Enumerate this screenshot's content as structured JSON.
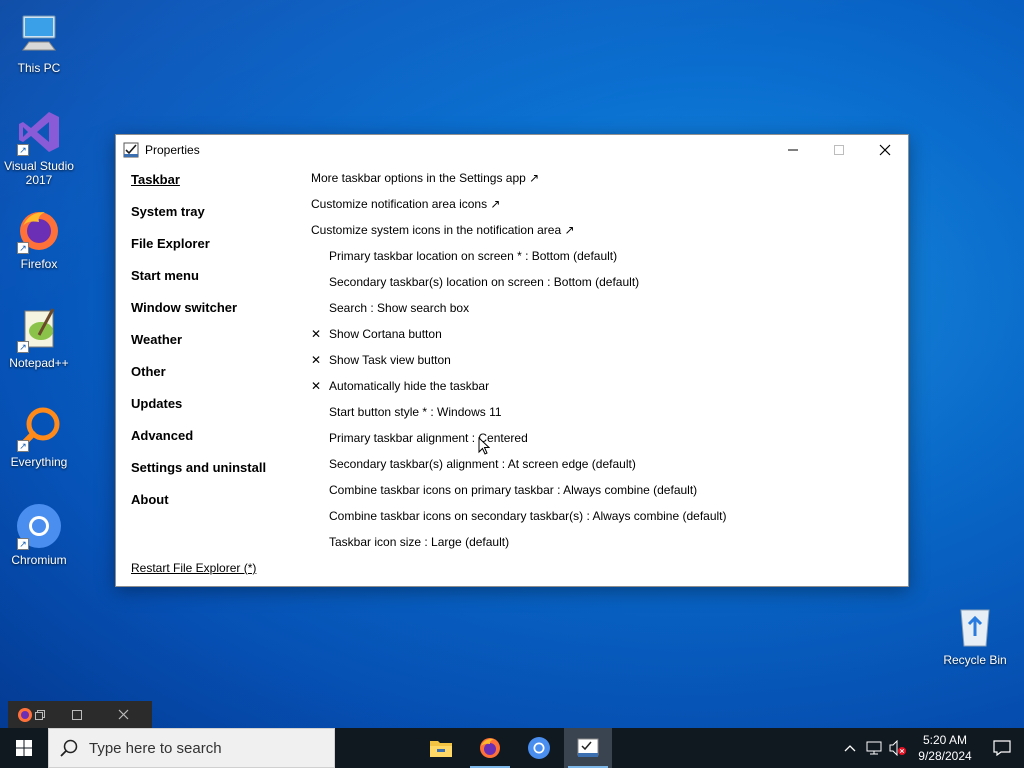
{
  "desktop": {
    "icons": [
      {
        "label": "This PC",
        "icon": "computer-icon"
      },
      {
        "label": "Visual Studio 2017",
        "icon": "visual-studio-icon"
      },
      {
        "label": "Firefox",
        "icon": "firefox-icon"
      },
      {
        "label": "Notepad++",
        "icon": "notepadpp-icon"
      },
      {
        "label": "Everything",
        "icon": "everything-search-icon"
      },
      {
        "label": "Chromium",
        "icon": "chromium-icon"
      },
      {
        "label": "Recycle Bin",
        "icon": "recycle-bin-icon"
      }
    ]
  },
  "window": {
    "title": "Properties",
    "icon": "properties-app-icon",
    "nav": [
      {
        "label": "Taskbar",
        "active": true
      },
      {
        "label": "System tray"
      },
      {
        "label": "File Explorer"
      },
      {
        "label": "Start menu"
      },
      {
        "label": "Window switcher"
      },
      {
        "label": "Weather"
      },
      {
        "label": "Other"
      },
      {
        "label": "Updates"
      },
      {
        "label": "Advanced"
      },
      {
        "label": "Settings and uninstall"
      },
      {
        "label": "About"
      }
    ],
    "restart_link": "Restart File Explorer (*)",
    "options": [
      {
        "text": "More taskbar options in the Settings app ↗",
        "type": "link"
      },
      {
        "text": "Customize notification area icons ↗",
        "type": "link"
      },
      {
        "text": "Customize system icons in the notification area ↗",
        "type": "link"
      },
      {
        "text": "Primary taskbar location on screen * : Bottom (default)",
        "type": "option",
        "mark": ""
      },
      {
        "text": "Secondary taskbar(s) location on screen : Bottom (default)",
        "type": "option",
        "mark": ""
      },
      {
        "text": "Search : Show search box",
        "type": "option",
        "mark": ""
      },
      {
        "text": "Show Cortana button",
        "type": "toggle",
        "mark": "✕"
      },
      {
        "text": "Show Task view button",
        "type": "toggle",
        "mark": "✕"
      },
      {
        "text": "Automatically hide the taskbar",
        "type": "toggle",
        "mark": "✕"
      },
      {
        "text": "Start button style * : Windows 11",
        "type": "option",
        "mark": ""
      },
      {
        "text": "Primary taskbar alignment : Centered",
        "type": "option",
        "mark": ""
      },
      {
        "text": "Secondary taskbar(s) alignment : At screen edge (default)",
        "type": "option",
        "mark": ""
      },
      {
        "text": "Combine taskbar icons on primary taskbar : Always combine (default)",
        "type": "option",
        "mark": ""
      },
      {
        "text": "Combine taskbar icons on secondary taskbar(s) : Always combine (default)",
        "type": "option",
        "mark": ""
      },
      {
        "text": "Taskbar icon size : Large (default)",
        "type": "option",
        "mark": ""
      }
    ]
  },
  "taskbar": {
    "search_placeholder": "Type here to search",
    "apps": [
      {
        "name": "File Explorer",
        "icon": "file-explorer-icon"
      },
      {
        "name": "Firefox",
        "icon": "firefox-icon"
      },
      {
        "name": "Chromium",
        "icon": "chromium-icon"
      },
      {
        "name": "Properties",
        "icon": "properties-app-icon"
      }
    ],
    "clock": {
      "time": "5:20 AM",
      "date": "9/28/2024"
    }
  },
  "colors": {
    "desktop_blue": "#0a6fd0",
    "taskbar": "#101820",
    "accent": "#7db6e8"
  }
}
